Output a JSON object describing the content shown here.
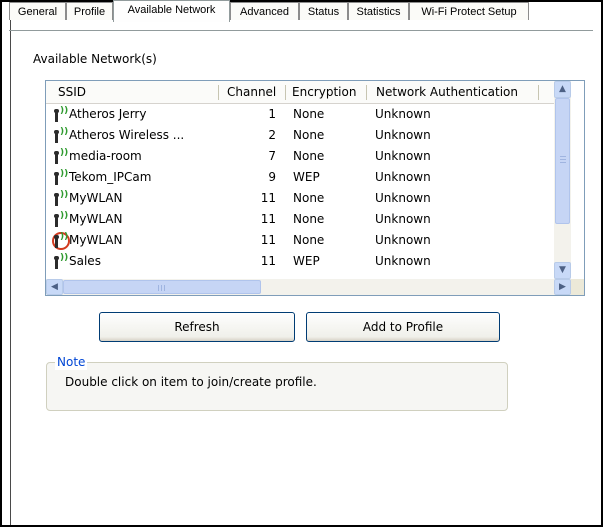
{
  "tabs": [
    {
      "label": "General"
    },
    {
      "label": "Profile"
    },
    {
      "label": "Available Network"
    },
    {
      "label": "Advanced"
    },
    {
      "label": "Status"
    },
    {
      "label": "Statistics"
    },
    {
      "label": "Wi-Fi Protect Setup"
    }
  ],
  "active_tab": "Available Network",
  "section_title": "Available Network(s)",
  "columns": {
    "ssid": "SSID",
    "channel": "Channel",
    "encryption": "Encryption",
    "auth": "Network Authentication"
  },
  "networks": [
    {
      "ssid": "Atheros Jerry",
      "channel": "1",
      "encryption": "None",
      "auth": "Unknown",
      "connected": false
    },
    {
      "ssid": "Atheros Wireless ...",
      "channel": "2",
      "encryption": "None",
      "auth": "Unknown",
      "connected": false
    },
    {
      "ssid": "media-room",
      "channel": "7",
      "encryption": "None",
      "auth": "Unknown",
      "connected": false
    },
    {
      "ssid": "Tekom_IPCam",
      "channel": "9",
      "encryption": "WEP",
      "auth": "Unknown",
      "connected": false
    },
    {
      "ssid": "MyWLAN",
      "channel": "11",
      "encryption": "None",
      "auth": "Unknown",
      "connected": false
    },
    {
      "ssid": "MyWLAN",
      "channel": "11",
      "encryption": "None",
      "auth": "Unknown",
      "connected": false
    },
    {
      "ssid": "MyWLAN",
      "channel": "11",
      "encryption": "None",
      "auth": "Unknown",
      "connected": true
    },
    {
      "ssid": "Sales",
      "channel": "11",
      "encryption": "WEP",
      "auth": "Unknown",
      "connected": false
    }
  ],
  "icons": {
    "network": "wireless-signal-icon",
    "scroll_up": "▲",
    "scroll_down": "▼",
    "scroll_left": "◀",
    "scroll_right": "▶"
  },
  "buttons": {
    "refresh": "Refresh",
    "add_to_profile": "Add to Profile"
  },
  "note": {
    "title": "Note",
    "text": "Double click on item to join/create profile."
  },
  "colors": {
    "accent": "#0046d5",
    "signal": "#2f9a2f",
    "connected_ring": "#d23a1e",
    "scrollbar": "#c6d5f5"
  }
}
